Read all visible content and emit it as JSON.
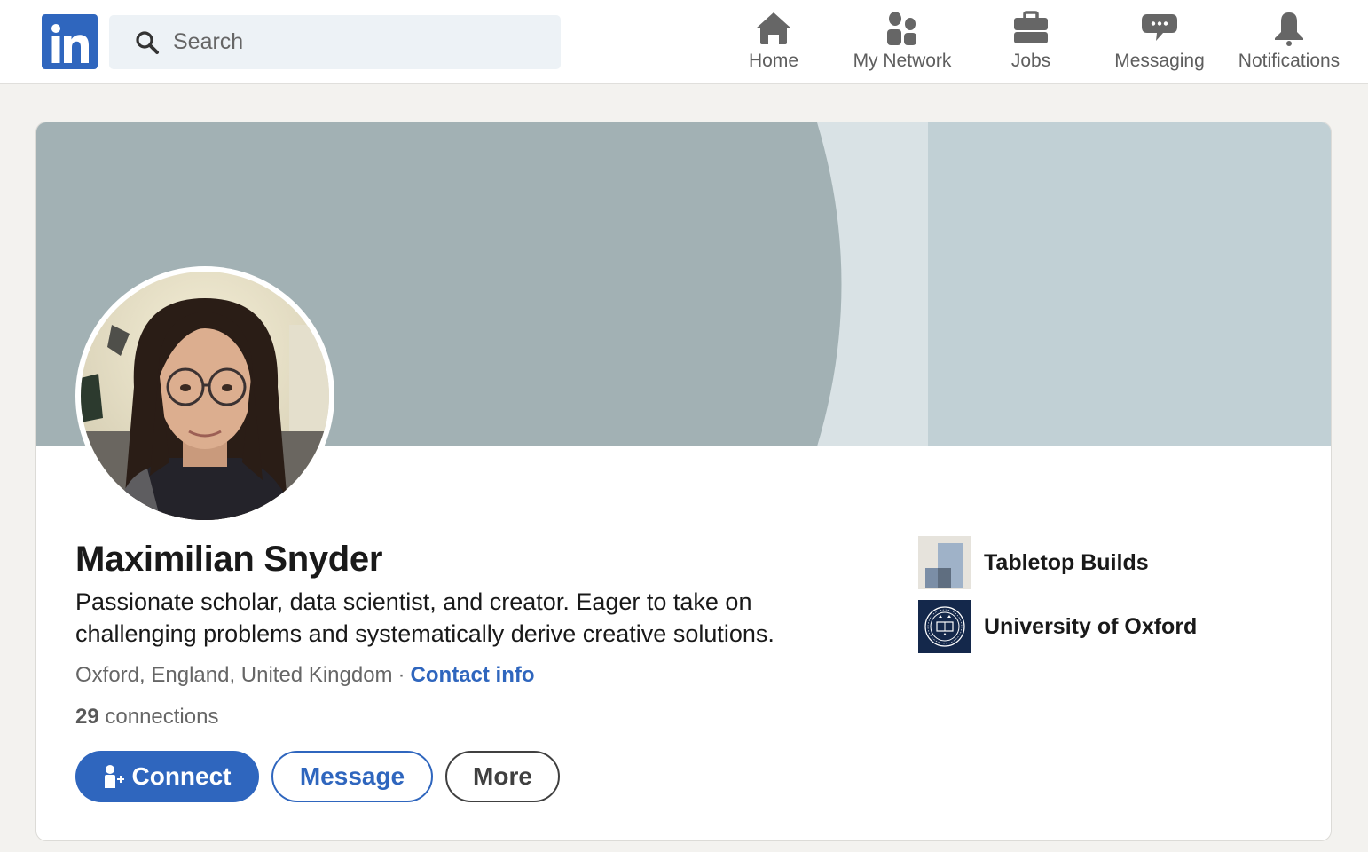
{
  "brand": {
    "logo_text": "in",
    "accent": "#2f66be"
  },
  "search": {
    "placeholder": "Search",
    "value": ""
  },
  "nav": {
    "items": [
      {
        "label": "Home",
        "icon": "home-icon"
      },
      {
        "label": "My Network",
        "icon": "network-icon"
      },
      {
        "label": "Jobs",
        "icon": "briefcase-icon"
      },
      {
        "label": "Messaging",
        "icon": "chat-bubble-icon"
      },
      {
        "label": "Notifications",
        "icon": "bell-icon"
      }
    ]
  },
  "profile": {
    "name": "Maximilian Snyder",
    "headline": "Passionate scholar, data scientist, and creator. Eager to take on challenging problems and systematically derive creative solutions.",
    "location": "Oxford, England, United Kingdom",
    "separator": "·",
    "contact_label": "Contact info",
    "connections_count": "29",
    "connections_label": "connections",
    "actions": {
      "connect": "Connect",
      "message": "Message",
      "more": "More"
    },
    "affiliations": [
      {
        "name": "Tabletop Builds",
        "icon": "tabletop-builds-logo"
      },
      {
        "name": "University of Oxford",
        "icon": "oxford-crest-logo"
      }
    ]
  },
  "colors": {
    "banner_dark": "#a2b1b4",
    "banner_light": "#d9e2e5",
    "banner_right": "#c1d0d5",
    "link_blue": "#2f66be",
    "oxford_navy": "#14284b"
  }
}
